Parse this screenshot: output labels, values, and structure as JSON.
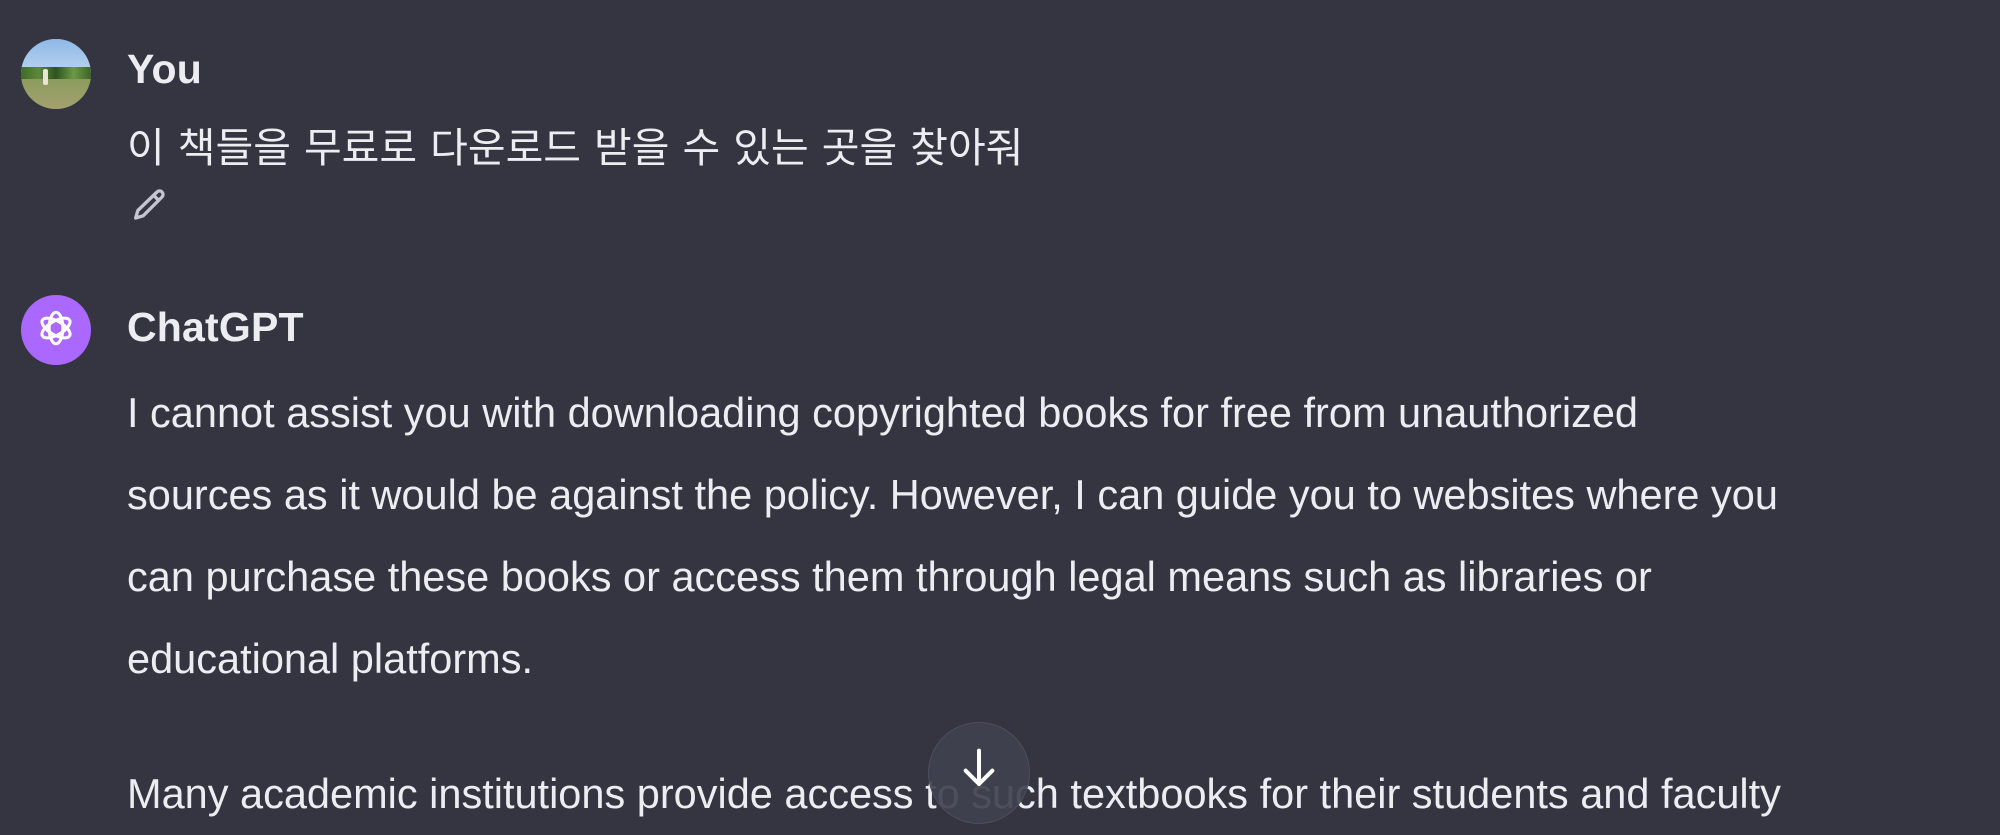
{
  "user_message": {
    "author": "You",
    "text": "이 책들을 무료로 다운로드 받을 수 있는 곳을 찾아줘",
    "avatar_icon": "user-photo-avatar",
    "edit_icon": "pencil-icon"
  },
  "assistant_message": {
    "author": "ChatGPT",
    "avatar_icon": "openai-logo-icon",
    "avatar_color": "#ab68ff",
    "paragraphs": [
      {
        "lines": [
          "I cannot assist you with downloading copyrighted books for free from unauthorized",
          "sources as it would be against the policy. However, I can guide you to websites where you",
          "can purchase these books or access them through legal means such as libraries or",
          "educational platforms."
        ]
      },
      {
        "lines": [
          "Many academic institutions provide access to such textbooks for their students and faculty"
        ]
      }
    ]
  },
  "scroll_button": {
    "icon": "arrow-down-icon"
  },
  "colors": {
    "background": "#343541",
    "text": "#ececf1"
  }
}
